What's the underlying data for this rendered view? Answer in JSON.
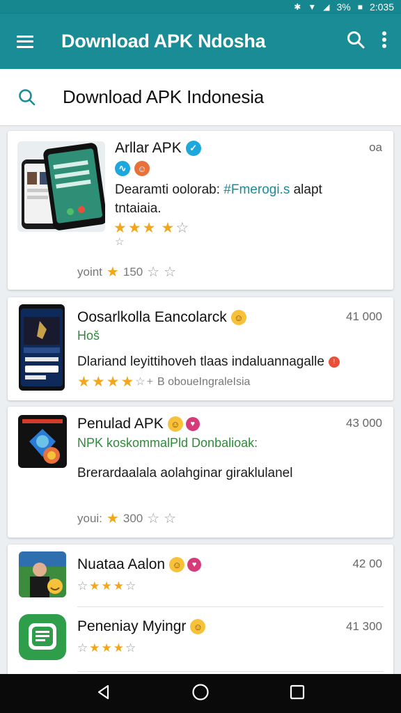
{
  "status_bar": {
    "battery": "3%",
    "time": "2:035"
  },
  "app_bar": {
    "title": "Download APK Ndosha",
    "menu_icon": "hamburger-icon",
    "search_icon": "search-icon",
    "more_icon": "more-vert-icon"
  },
  "search": {
    "query": "Download APK Indonesia"
  },
  "colors": {
    "app_bar": "#1a8c96",
    "status_bar": "#16868f",
    "star": "#f2a71b",
    "developer": "#2e8b3a",
    "link": "#1a8c96"
  },
  "apps": [
    {
      "name": "Arllar APK",
      "size": "oa",
      "desc_line1_prefix": "Dearamti oolorab: ",
      "desc_line1_link": "#Fmerogi.s",
      "desc_line1_suffix": " alapt",
      "desc_line2": "tntaiaia.",
      "rating": 3.5,
      "meta_prefix": "yoint",
      "meta_count": "150"
    },
    {
      "name": "Oosarlkolla Eancolarck",
      "size": "41 000",
      "developer": "Hoš",
      "desc": "Dlariand leyittihoveh tlaas indaluannagalle",
      "rating": 3.5,
      "meta_text": "B oboueIngraleIsia"
    },
    {
      "name": "Penulad APK",
      "size": "43 000",
      "developer": "NPK koskommalPld Donbalioak:",
      "desc": "Brerardaalala aolahginar giraklulanel",
      "meta_prefix": "youi:",
      "meta_count": "300"
    },
    {
      "name": "Nuataa Aalon",
      "size": "42 00",
      "rating": 3
    },
    {
      "name": "Peneniay Myingr",
      "size": "41 300",
      "rating": 3
    }
  ]
}
